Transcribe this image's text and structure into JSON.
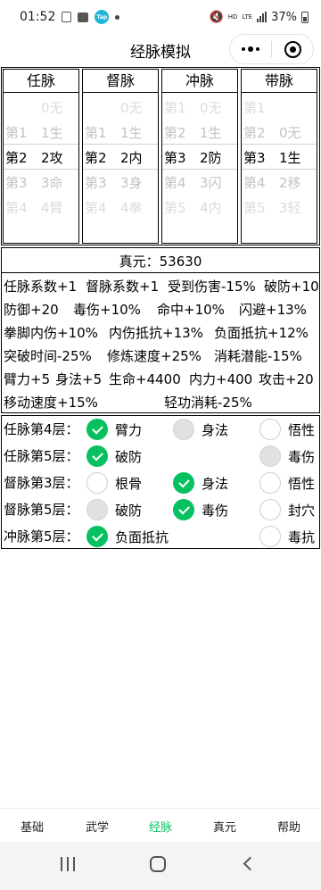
{
  "status": {
    "time": "01:52",
    "hd": "HD",
    "lte": "LTE",
    "battery": "37%",
    "tap_label": "Tap"
  },
  "header": {
    "title": "经脉模拟"
  },
  "meridians": [
    {
      "title": "任脉",
      "rows": [
        [
          "",
          "0无"
        ],
        [
          "第1",
          "1生"
        ],
        [
          "第2",
          "2攻"
        ],
        [
          "第3",
          "3命"
        ],
        [
          "第4",
          "4臂"
        ]
      ]
    },
    {
      "title": "督脉",
      "rows": [
        [
          "",
          "0无"
        ],
        [
          "第1",
          "1生"
        ],
        [
          "第2",
          "2内"
        ],
        [
          "第3",
          "3身"
        ],
        [
          "第4",
          "4拳"
        ]
      ]
    },
    {
      "title": "冲脉",
      "rows": [
        [
          "第1",
          "0无"
        ],
        [
          "第2",
          "1生"
        ],
        [
          "第3",
          "2防"
        ],
        [
          "第4",
          "3闪"
        ],
        [
          "第5",
          "4内"
        ]
      ]
    },
    {
      "title": "带脉",
      "rows": [
        [
          "第1",
          ""
        ],
        [
          "第2",
          "0无"
        ],
        [
          "第3",
          "1生"
        ],
        [
          "第4",
          "2移"
        ],
        [
          "第5",
          "3轻"
        ]
      ]
    }
  ],
  "stats": {
    "zhenyuan": "真元：53630",
    "lines": [
      [
        "任脉系数+1",
        "督脉系数+1",
        "受到伤害-15%",
        "破防+10"
      ],
      [
        "防御+20",
        "毒伤+10%",
        "命中+10%",
        "闪避+13%"
      ],
      [
        "拳脚内伤+10%",
        "内伤抵抗+13%",
        "负面抵抗+12%"
      ],
      [
        "突破时间-25%",
        "修炼速度+25%",
        "消耗潜能-15%"
      ],
      [
        "臂力+5",
        "身法+5",
        "生命+4400",
        "内力+400",
        "攻击+20"
      ],
      [
        "移动速度+15%",
        "轻功消耗-25%"
      ]
    ]
  },
  "levels": [
    {
      "label": "任脉第4层：",
      "options": [
        {
          "text": "臂力",
          "state": "on"
        },
        {
          "text": "身法",
          "state": "dis"
        },
        {
          "text": "悟性",
          "state": "off"
        }
      ]
    },
    {
      "label": "任脉第5层：",
      "options": [
        {
          "text": "破防",
          "state": "on"
        },
        {
          "text": "毒伤",
          "state": "dis"
        }
      ]
    },
    {
      "label": "督脉第3层：",
      "options": [
        {
          "text": "根骨",
          "state": "off"
        },
        {
          "text": "身法",
          "state": "on"
        },
        {
          "text": "悟性",
          "state": "off"
        }
      ]
    },
    {
      "label": "督脉第5层：",
      "options": [
        {
          "text": "破防",
          "state": "dis"
        },
        {
          "text": "毒伤",
          "state": "on"
        },
        {
          "text": "封穴",
          "state": "off"
        }
      ]
    },
    {
      "label": "冲脉第5层：",
      "options": [
        {
          "text": "负面抵抗",
          "state": "on"
        },
        {
          "text": "毒抗",
          "state": "off"
        }
      ]
    }
  ],
  "nav": [
    "基础",
    "武学",
    "经脉",
    "真元",
    "帮助"
  ],
  "nav_active": "经脉",
  "colors": {
    "accent": "#07c160",
    "disabled": "#e1e1e1"
  }
}
